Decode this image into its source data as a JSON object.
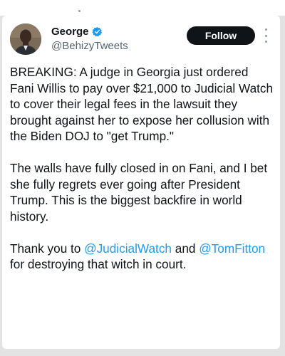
{
  "author": {
    "display_name": "George",
    "handle": "@BehizyTweets",
    "verified_icon": "verified-badge-icon",
    "badge_color": "#1d9bf0"
  },
  "actions": {
    "follow_label": "Follow",
    "more_icon": "more-vertical-icon"
  },
  "tweet": {
    "paragraph1": "BREAKING: A judge in Georgia just ordered Fani Willis to pay over $21,000 to Judicial Watch to cover their legal fees in the lawsuit they brought against her to expose her collusion with the Biden DOJ to \"get Trump.\"",
    "paragraph2": "The walls have fully closed in on Fani, and I bet she fully regrets ever going after President Trump. This is the biggest backfire in world history.",
    "paragraph3": {
      "prefix": "Thank you to ",
      "mention1": "@JudicialWatch",
      "middle1": " and ",
      "mention2": "@TomFitton",
      "suffix": " for destroying that witch in court."
    }
  },
  "colors": {
    "text": "#0f1419",
    "secondary": "#536471",
    "link": "#1d9bf0",
    "button_bg": "#0f1419"
  }
}
